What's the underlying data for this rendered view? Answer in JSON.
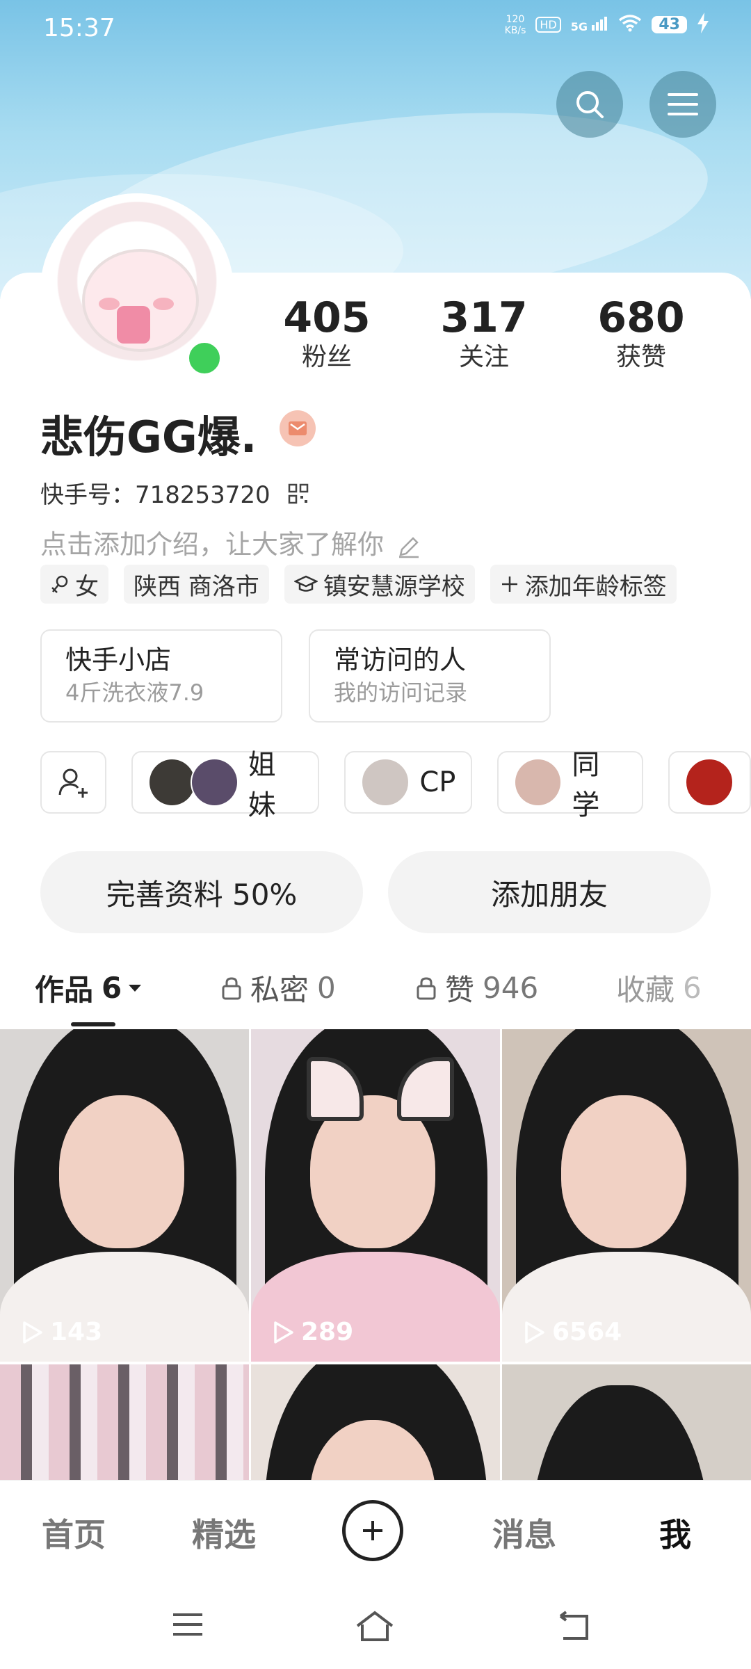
{
  "status_bar": {
    "time": "15:37",
    "net_speed_value": "120",
    "net_speed_unit": "KB/s",
    "hd_label": "HD",
    "signal_label": "5G",
    "battery": "43"
  },
  "profile": {
    "name": "悲伤GG爆.",
    "uid_label": "快手号：",
    "uid_value": "718253720",
    "bio_placeholder": "点击添加介绍，让大家了解你",
    "online": true
  },
  "stats": [
    {
      "value": "405",
      "label": "粉丝"
    },
    {
      "value": "317",
      "label": "关注"
    },
    {
      "value": "680",
      "label": "获赞"
    }
  ],
  "tags": [
    {
      "icon": "female-icon",
      "label": "女"
    },
    {
      "icon": "",
      "label": "陕西 商洛市"
    },
    {
      "icon": "graduation-cap-icon",
      "label": "镇安慧源学校"
    },
    {
      "icon": "plus-icon",
      "label": "添加年龄标签"
    }
  ],
  "shortcuts": [
    {
      "title": "快手小店",
      "subtitle": "4斤洗衣液7.9"
    },
    {
      "title": "常访问的人",
      "subtitle": "我的访问记录"
    }
  ],
  "groups": [
    {
      "label": "姐妹"
    },
    {
      "label": "CP"
    },
    {
      "label": "同学"
    }
  ],
  "actions": {
    "complete_profile": "完善资料 50%",
    "add_friend": "添加朋友"
  },
  "tabs": [
    {
      "label": "作品",
      "count": "6",
      "active": true
    },
    {
      "label": "私密",
      "count": "0",
      "locked": true
    },
    {
      "label": "赞",
      "count": "946",
      "locked": true
    },
    {
      "label": "收藏",
      "count": "6"
    }
  ],
  "videos": [
    {
      "plays": "143"
    },
    {
      "plays": "289"
    },
    {
      "plays": "6564"
    }
  ],
  "bottom_nav": {
    "home": "首页",
    "featured": "精选",
    "messages": "消息",
    "me": "我"
  },
  "colors": {
    "online": "#3fcf5a",
    "hero_top": "#79c3e6",
    "text_primary": "#222222",
    "text_muted": "#a5a5a5"
  }
}
